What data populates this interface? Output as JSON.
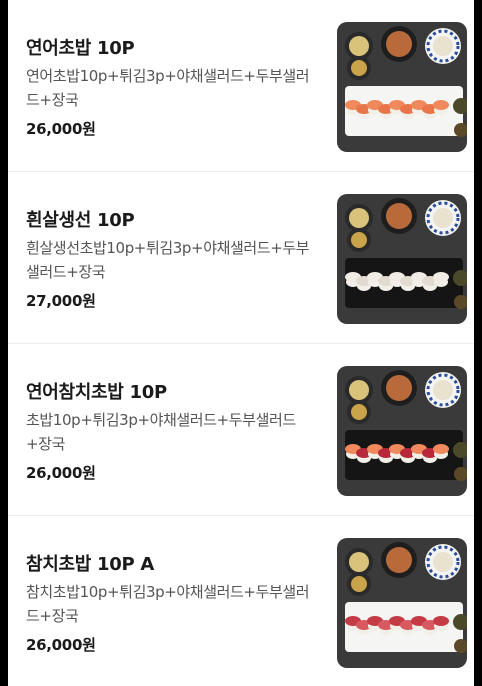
{
  "menu": {
    "items": [
      {
        "name": "연어초밥 10P",
        "description": "연어초밥10p+튀김3p+야채샐러드+두부샐러드+장국",
        "price": "26,000원",
        "photo": "salmon-sushi-set",
        "sushi": "salmon",
        "plate": "white"
      },
      {
        "name": "흰살생선 10P",
        "description": "흰살생선초밥10p+튀김3p+야채샐러드+두부샐러드+장국",
        "price": "27,000원",
        "photo": "white-fish-sushi-set",
        "sushi": "whitefish",
        "plate": "black"
      },
      {
        "name": "연어참치초밥 10P",
        "description": "초밥10p+튀김3p+야채샐러드+두부샐러드+장국",
        "price": "26,000원",
        "photo": "salmon-tuna-sushi-set",
        "sushi": "mixed",
        "plate": "black"
      },
      {
        "name": "참치초밥 10P A",
        "description": "참치초밥10p+튀김3p+야채샐러드+두부샐러드+장국",
        "price": "26,000원",
        "photo": "tuna-sushi-set",
        "sushi": "tuna",
        "plate": "white"
      }
    ]
  }
}
